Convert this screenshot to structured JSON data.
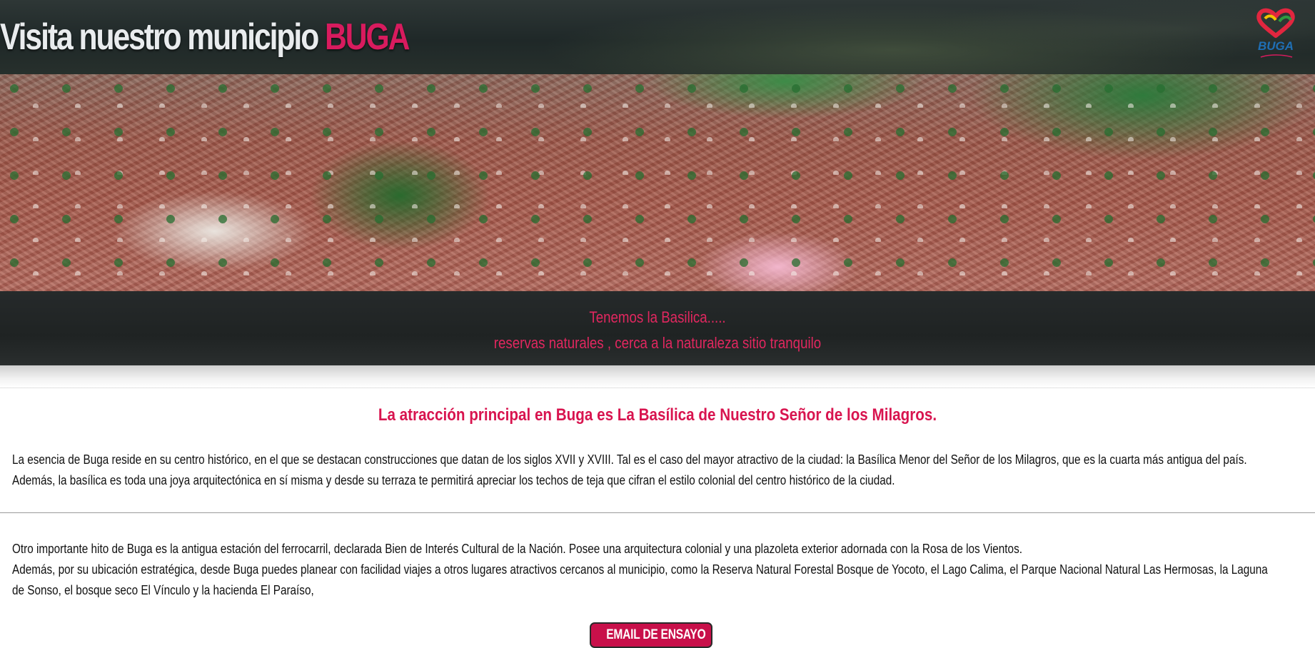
{
  "header": {
    "title_main": "Visita nuestro municipio",
    "title_accent": "BUGA",
    "logo_text": "BUGA",
    "logo_icon": "heart-logo-icon"
  },
  "hero": {
    "caption_line1": "Tenemos la Basilica.....",
    "caption_line2": "reservas naturales , cerca a la naturaleza sitio tranquilo"
  },
  "content": {
    "headline": "La atracción principal en Buga es La Basílica de Nuestro Señor de los Milagros.",
    "paragraph1": [
      "La esencia de Buga reside en su centro histórico, en el que se destacan construcciones que datan de los siglos XVII y XVIII. Tal es el caso del mayor atractivo de la ciudad: la Basílica Menor del Señor de los Milagros, que es la cuarta más antigua del país.",
      "Además, la basílica es toda una joya arquitectónica en sí misma y desde su terraza te permitirá apreciar los techos de teja que cifran el estilo colonial del centro histórico de la ciudad."
    ],
    "paragraph2": [
      "Otro importante hito de Buga es la antigua estación del ferrocarril, declarada Bien de Interés Cultural de la Nación. Posee una arquitectura colonial y una plazoleta exterior adornada con la Rosa de los Vientos.",
      "Además, por su ubicación estratégica, desde Buga puedes planear con facilidad viajes a otros lugares atractivos cercanos al municipio, como la Reserva Natural Forestal Bosque de Yocoto, el Lago Calima, el Parque Nacional Natural Las Hermosas, la Laguna",
      "de Sonso, el bosque seco El Vínculo y la hacienda El Paraíso,"
    ]
  },
  "email_button": {
    "label": "EMAIL DE ENSAYO",
    "icon": "envelope-icon"
  },
  "colors": {
    "accent": "#d8144f",
    "button": "#c8104a",
    "header_bg": "#1f2828"
  }
}
